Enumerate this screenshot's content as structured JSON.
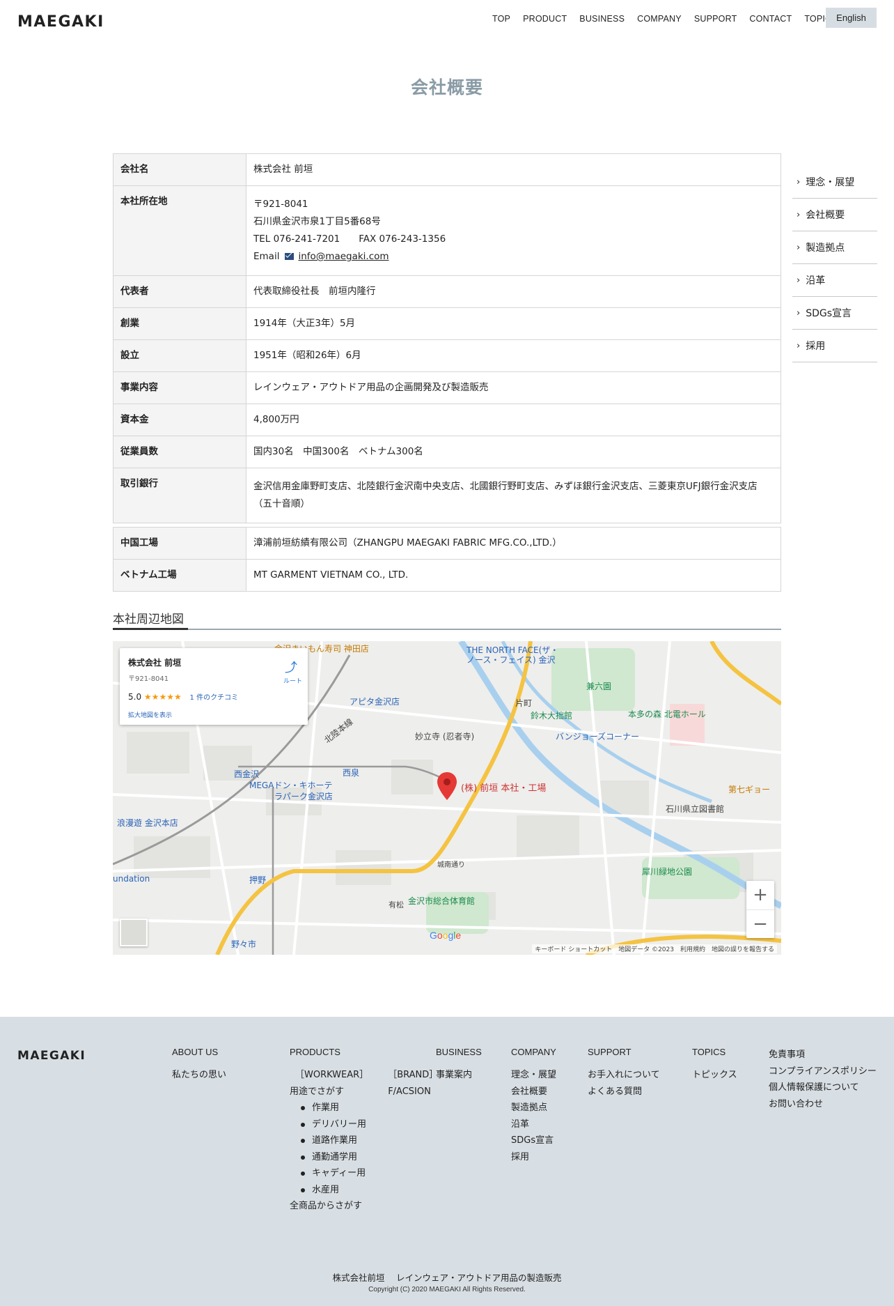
{
  "header": {
    "logo_text": "MAEGAKI",
    "nav": [
      "TOP",
      "PRODUCT",
      "BUSINESS",
      "COMPANY",
      "SUPPORT",
      "CONTACT",
      "TOPICS"
    ],
    "lang": "English"
  },
  "page_title": "会社概要",
  "company_table": [
    {
      "label": "会社名",
      "lines": [
        "株式会社 前垣"
      ]
    },
    {
      "label": "本社所在地",
      "lines": [
        "〒921-8041",
        "石川県金沢市泉1丁目5番68号",
        "TEL 076-241-7201　　FAX 076-243-1356"
      ],
      "email_label": "Email",
      "email": "info@maegaki.com"
    },
    {
      "label": "代表者",
      "lines": [
        "代表取締役社長　前垣内隆行"
      ]
    },
    {
      "label": "創業",
      "lines": [
        "1914年（大正3年）5月"
      ]
    },
    {
      "label": "設立",
      "lines": [
        "1951年（昭和26年）6月"
      ]
    },
    {
      "label": "事業内容",
      "lines": [
        "レインウェア・アウトドア用品の企画開発及び製造販売"
      ]
    },
    {
      "label": "資本金",
      "lines": [
        "4,800万円"
      ]
    },
    {
      "label": "従業員数",
      "lines": [
        "国内30名　中国300名　ベトナム300名"
      ]
    },
    {
      "label": "取引銀行",
      "lines": [
        "金沢信用金庫野町支店、北陸銀行金沢南中央支店、北國銀行野町支店、みずほ銀行金沢支店、三菱東京UFJ銀行金沢支店（五十音順）"
      ]
    }
  ],
  "factory_table": [
    {
      "label": "中国工場",
      "value": "漳浦前垣紡績有限公司（ZHANGPU MAEGAKI FABRIC MFG.CO.,LTD.）"
    },
    {
      "label": "ベトナム工場",
      "value": "MT GARMENT VIETNAM CO., LTD."
    }
  ],
  "side_menu": [
    "理念・展望",
    "会社概要",
    "製造拠点",
    "沿革",
    "SDGs宣言",
    "採用"
  ],
  "map": {
    "heading": "本社周辺地図",
    "card_title": "株式会社 前垣",
    "card_address": "〒921-8041",
    "card_rating": "5.0",
    "card_stars": "★★★★★",
    "card_reviews": "1 件のクチコミ",
    "card_more": "拡大地図を表示",
    "card_directions": "ルート",
    "pin_label": "(株) 前垣 本社・工場",
    "labels": {
      "north_face": "THE NORTH FACE(ザ・",
      "north_face2": "ノース・フェイス) 金沢",
      "kenrokuen": "兼六園",
      "suzuki": "鈴木大拙館",
      "honda": "本多の森 北電ホール",
      "banjo": "バンジョーズコーナー",
      "apita": "アピタ金沢店",
      "myoryuji": "妙立寺 (忍者寺)",
      "mega": "MEGAドン・キホーテ",
      "mega2": "ラパーク金沢店",
      "nishikanazawa": "西金沢",
      "nishiizumi": "西泉",
      "roman": "浪漫遊 金沢本店",
      "undation": "undation",
      "oshino": "押野",
      "sogo": "金沢市総合体育館",
      "nonoichi": "野々市",
      "library": "石川県立図書館",
      "saigawa": "犀川緑地公園",
      "daishichi": "第七ギョー",
      "hokuriku": "北陸本線",
      "katamachi": "片町",
      "arimatsu": "有松",
      "jonan": "城南通り",
      "nomachi": "金沢まいもん寿司 神田店"
    },
    "zoom_in": "+",
    "zoom_out": "−",
    "google": "Google",
    "attribution": "キーボード ショートカット　地図データ ©2023　利用規約　地図の誤りを報告する"
  },
  "footer": {
    "logo_text": "MAEGAKI",
    "about": {
      "heading": "ABOUT US",
      "links": [
        "私たちの思い"
      ]
    },
    "products": {
      "heading": "PRODUCTS",
      "workwear": "［WORKWEAR］",
      "brand": "［BRAND］",
      "by_use": "用途でさがす",
      "brand_item": "F/ACSION",
      "uses": [
        "作業用",
        "デリバリー用",
        "道路作業用",
        "通勤通学用",
        "キャディー用",
        "水産用"
      ],
      "all": "全商品からさがす"
    },
    "business": {
      "heading": "BUSINESS",
      "links": [
        "事業案内"
      ]
    },
    "company": {
      "heading": "COMPANY",
      "links": [
        "理念・展望",
        "会社概要",
        "製造拠点",
        "沿革",
        "SDGs宣言",
        "採用"
      ]
    },
    "support": {
      "heading": "SUPPORT",
      "links": [
        "お手入れについて",
        "よくある質問"
      ]
    },
    "topics": {
      "heading": "TOPICS",
      "links": [
        "トピックス"
      ]
    },
    "misc": [
      "免責事項",
      "コンプライアンスポリシー",
      "個人情報保護について",
      "お問い合わせ"
    ],
    "company_line": "株式会社前垣　 レインウェア・アウトドア用品の製造販売",
    "copyright": "Copyright (C) 2020 MAEGAKI All Rights Reserved."
  }
}
